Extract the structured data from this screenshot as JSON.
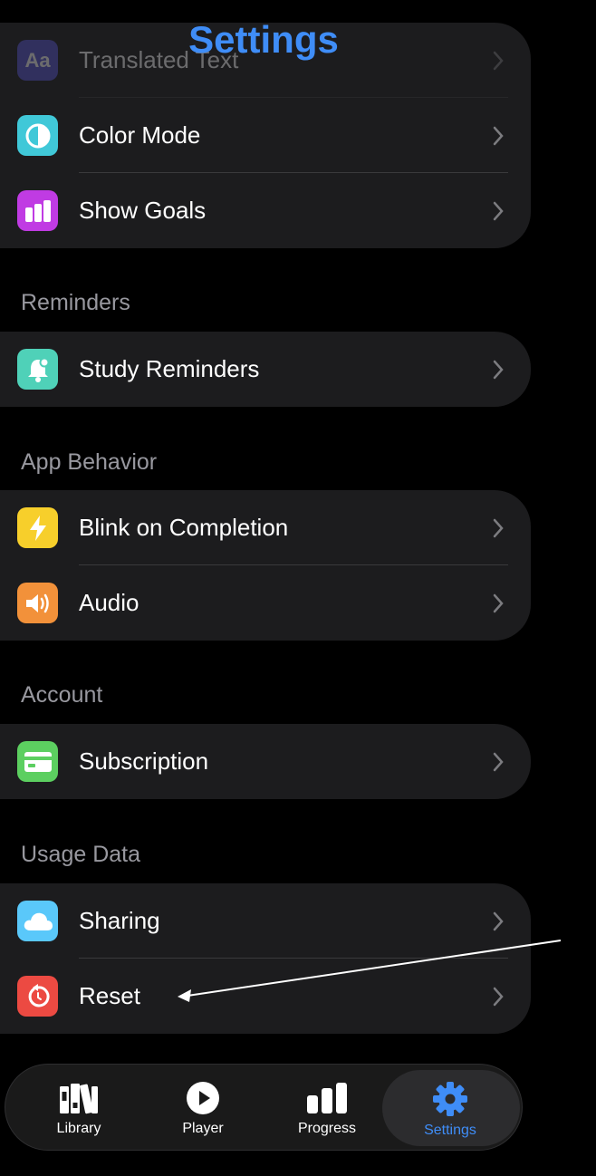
{
  "header": {
    "title": "Settings"
  },
  "groups": {
    "appearance": {
      "items": [
        {
          "label": "Translated Text",
          "icon": "text-size-icon",
          "color": "#5856d6"
        },
        {
          "label": "Color Mode",
          "icon": "color-mode-icon",
          "color": "#40c8d8"
        },
        {
          "label": "Show Goals",
          "icon": "goals-bars-icon",
          "color": "#c03be3"
        }
      ]
    },
    "reminders": {
      "header": "Reminders",
      "items": [
        {
          "label": "Study Reminders",
          "icon": "bell-icon",
          "color": "#4fd1b8"
        }
      ]
    },
    "behavior": {
      "header": "App Behavior",
      "items": [
        {
          "label": "Blink on Completion",
          "icon": "lightning-icon",
          "color": "#f7cf2b"
        },
        {
          "label": "Audio",
          "icon": "speaker-icon",
          "color": "#f2913a"
        }
      ]
    },
    "account": {
      "header": "Account",
      "items": [
        {
          "label": "Subscription",
          "icon": "credit-card-icon",
          "color": "#5ccf60"
        }
      ]
    },
    "usage": {
      "header": "Usage Data",
      "items": [
        {
          "label": "Sharing",
          "icon": "cloud-icon",
          "color": "#5ac8fa"
        },
        {
          "label": "Reset",
          "icon": "reset-icon",
          "color": "#ec4a42"
        }
      ]
    }
  },
  "tabbar": {
    "tabs": [
      {
        "label": "Library",
        "icon": "library-icon"
      },
      {
        "label": "Player",
        "icon": "play-icon"
      },
      {
        "label": "Progress",
        "icon": "progress-bars-icon"
      },
      {
        "label": "Settings",
        "icon": "gear-icon",
        "active": true
      }
    ],
    "accent": "#3f8df7"
  }
}
